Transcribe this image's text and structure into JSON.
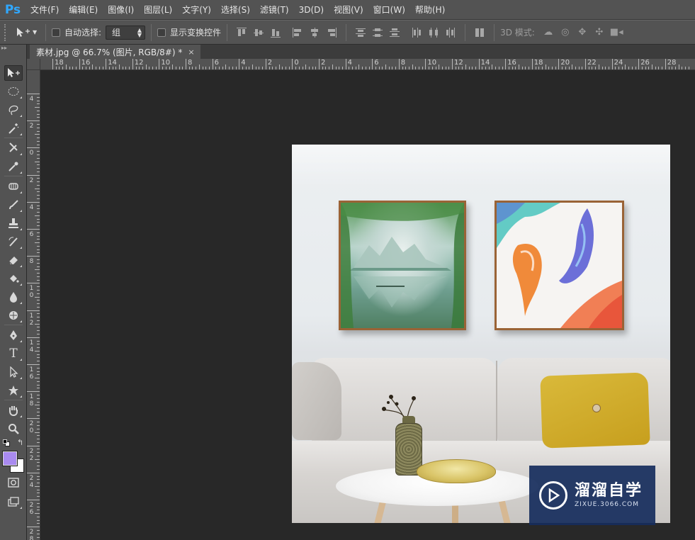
{
  "app": {
    "logo": "Ps"
  },
  "menu": [
    "文件(F)",
    "编辑(E)",
    "图像(I)",
    "图层(L)",
    "文字(Y)",
    "选择(S)",
    "滤镜(T)",
    "3D(D)",
    "视图(V)",
    "窗口(W)",
    "帮助(H)"
  ],
  "options": {
    "auto_select_label": "自动选择:",
    "auto_select_value": "组",
    "show_transform_label": "显示变换控件",
    "mode_3d_label": "3D 模式:"
  },
  "document_tab": {
    "title": "素材.jpg @ 66.7% (图片, RGB/8#) *",
    "close": "×"
  },
  "toolbar": {
    "collapse": "▸▸",
    "tools": [
      "move-tool",
      "marquee-tool",
      "lasso-tool",
      "magic-wand-tool",
      "crop-tool",
      "eyedropper-tool",
      "healing-brush-tool",
      "brush-tool",
      "clone-stamp-tool",
      "history-brush-tool",
      "eraser-tool",
      "paint-bucket-tool",
      "blur-tool",
      "dodge-tool",
      "pen-tool",
      "type-tool",
      "path-selection-tool",
      "custom-shape-tool",
      "hand-tool",
      "zoom-tool"
    ],
    "foreground_color": "#a98af0",
    "background_color": "#ffffff"
  },
  "rulers": {
    "horizontal": [
      "18",
      "16",
      "14",
      "12",
      "10",
      "8",
      "6",
      "4",
      "2",
      "0",
      "2",
      "4",
      "6",
      "8",
      "10",
      "12",
      "14",
      "16",
      "18",
      "20",
      "22",
      "24",
      "26",
      "28"
    ],
    "vertical": [
      "4",
      "2",
      "0",
      "2",
      "4",
      "6",
      "8",
      "10",
      "12",
      "14",
      "16",
      "18",
      "20",
      "22",
      "24",
      "26",
      "28"
    ]
  },
  "watermark": {
    "title": "溜溜自学",
    "url": "ZIXUE.3066.COM"
  },
  "colors": {
    "ps_blue": "#30a8ff",
    "chrome": "#535353",
    "canvas_bg": "#282828",
    "frame_wood": "#9a6336",
    "pillow": "#d4b232"
  }
}
